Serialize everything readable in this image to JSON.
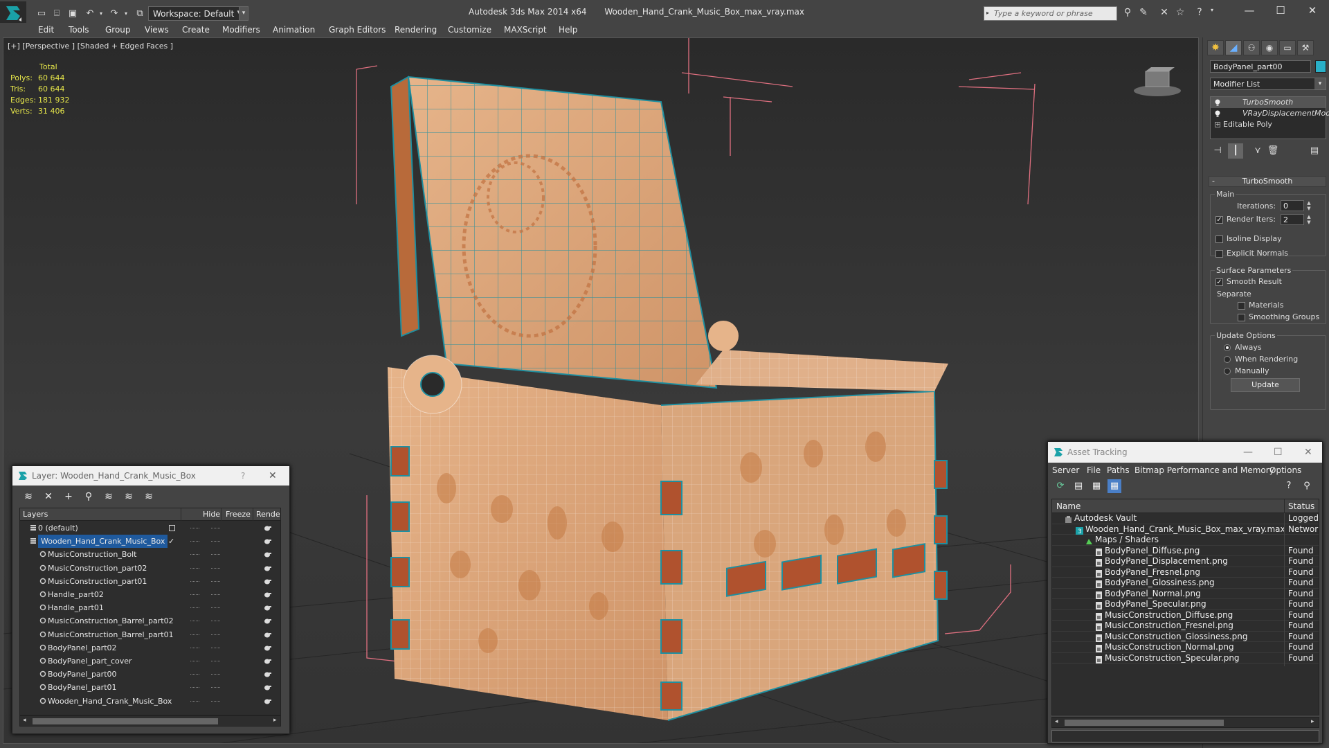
{
  "titlebar": {
    "workspace": "Workspace: Default",
    "app_name": "Autodesk 3ds Max  2014 x64",
    "file_name": "Wooden_Hand_Crank_Music_Box_max_vray.max",
    "search_placeholder": "Type a keyword or phrase",
    "icons": [
      "new-file-icon",
      "open-file-icon",
      "save-icon",
      "undo-icon",
      "redo-icon",
      "project-icon"
    ]
  },
  "menu": [
    "Edit",
    "Tools",
    "Group",
    "Views",
    "Create",
    "Modifiers",
    "Animation",
    "Graph Editors",
    "Rendering",
    "Customize",
    "MAXScript",
    "Help"
  ],
  "viewport": {
    "label": "[+] [Perspective ] [Shaded + Edged Faces ]",
    "stats": {
      "header": "Total",
      "rows": [
        {
          "k": "Polys:",
          "v": "60 644"
        },
        {
          "k": "Tris:",
          "v": "60 644"
        },
        {
          "k": "Edges:",
          "v": "181 932"
        },
        {
          "k": "Verts:",
          "v": "31 406"
        }
      ]
    }
  },
  "command_panel": {
    "object_name": "BodyPanel_part00",
    "object_color": "#2ab0c8",
    "modifier_list": "Modifier List",
    "stack": [
      {
        "label": "TurboSmooth",
        "type": "modifier",
        "selected": true
      },
      {
        "label": "VRayDisplacementMod",
        "type": "modifier",
        "selected": false
      },
      {
        "label": "Editable Poly",
        "type": "base",
        "selected": false
      }
    ],
    "rollout": {
      "title": "TurboSmooth",
      "main_group": "Main",
      "iterations_label": "Iterations:",
      "iterations_value": "0",
      "render_iters_label": "Render Iters:",
      "render_iters_value": "2",
      "render_iters_checked": true,
      "isoline_label": "Isoline Display",
      "explicit_normals_label": "Explicit Normals",
      "surface_group": "Surface Parameters",
      "smooth_result_label": "Smooth Result",
      "separate_label": "Separate",
      "materials_label": "Materials",
      "smoothing_groups_label": "Smoothing Groups",
      "update_group": "Update Options",
      "always_label": "Always",
      "when_rendering_label": "When Rendering",
      "manually_label": "Manually",
      "update_button": "Update"
    }
  },
  "layer_dialog": {
    "title": "Layer: Wooden_Hand_Crank_Music_Box",
    "help": "?",
    "columns": {
      "layers": "Layers",
      "hide": "Hide",
      "freeze": "Freeze",
      "render": "Render"
    },
    "rows": [
      {
        "name": "0 (default)",
        "level": 0,
        "type": "layer",
        "selected": false
      },
      {
        "name": "Wooden_Hand_Crank_Music_Box",
        "level": 0,
        "type": "layer",
        "selected": true
      },
      {
        "name": "MusicConstruction_Bolt",
        "level": 1,
        "type": "object",
        "selected": false
      },
      {
        "name": "MusicConstruction_part02",
        "level": 1,
        "type": "object",
        "selected": false
      },
      {
        "name": "MusicConstruction_part01",
        "level": 1,
        "type": "object",
        "selected": false
      },
      {
        "name": "Handle_part02",
        "level": 1,
        "type": "object",
        "selected": false
      },
      {
        "name": "Handle_part01",
        "level": 1,
        "type": "object",
        "selected": false
      },
      {
        "name": "MusicConstruction_Barrel_part02",
        "level": 1,
        "type": "object",
        "selected": false
      },
      {
        "name": "MusicConstruction_Barrel_part01",
        "level": 1,
        "type": "object",
        "selected": false
      },
      {
        "name": "BodyPanel_part02",
        "level": 1,
        "type": "object",
        "selected": false
      },
      {
        "name": "BodyPanel_part_cover",
        "level": 1,
        "type": "object",
        "selected": false
      },
      {
        "name": "BodyPanel_part00",
        "level": 1,
        "type": "object",
        "selected": false
      },
      {
        "name": "BodyPanel_part01",
        "level": 1,
        "type": "object",
        "selected": false
      },
      {
        "name": "Wooden_Hand_Crank_Music_Box",
        "level": 1,
        "type": "object",
        "selected": false
      }
    ]
  },
  "asset_dialog": {
    "title": "Asset Tracking",
    "menu": [
      "Server",
      "File",
      "Paths",
      "Bitmap Performance and Memory",
      "Options"
    ],
    "columns": {
      "name": "Name",
      "status": "Status"
    },
    "rows": [
      {
        "name": "Autodesk Vault",
        "status": "Logged Out",
        "level": 0,
        "icon": "vault"
      },
      {
        "name": "Wooden_Hand_Crank_Music_Box_max_vray.max",
        "status": "Network",
        "level": 1,
        "icon": "max"
      },
      {
        "name": "Maps / Shaders",
        "status": "",
        "level": 2,
        "icon": "maps"
      },
      {
        "name": "BodyPanel_Diffuse.png",
        "status": "Found",
        "level": 3,
        "icon": "file"
      },
      {
        "name": "BodyPanel_Displacement.png",
        "status": "Found",
        "level": 3,
        "icon": "file"
      },
      {
        "name": "BodyPanel_Fresnel.png",
        "status": "Found",
        "level": 3,
        "icon": "file"
      },
      {
        "name": "BodyPanel_Glossiness.png",
        "status": "Found",
        "level": 3,
        "icon": "file"
      },
      {
        "name": "BodyPanel_Normal.png",
        "status": "Found",
        "level": 3,
        "icon": "file"
      },
      {
        "name": "BodyPanel_Specular.png",
        "status": "Found",
        "level": 3,
        "icon": "file"
      },
      {
        "name": "MusicConstruction_Diffuse.png",
        "status": "Found",
        "level": 3,
        "icon": "file"
      },
      {
        "name": "MusicConstruction_Fresnel.png",
        "status": "Found",
        "level": 3,
        "icon": "file"
      },
      {
        "name": "MusicConstruction_Glossiness.png",
        "status": "Found",
        "level": 3,
        "icon": "file"
      },
      {
        "name": "MusicConstruction_Normal.png",
        "status": "Found",
        "level": 3,
        "icon": "file"
      },
      {
        "name": "MusicConstruction_Specular.png",
        "status": "Found",
        "level": 3,
        "icon": "file"
      }
    ]
  },
  "colors": {
    "selection": "#1f5a9e",
    "stats_text": "#e6e64a",
    "wood": "#d9a276",
    "wire": "#2aa7b5",
    "bbox": "#e07080"
  }
}
